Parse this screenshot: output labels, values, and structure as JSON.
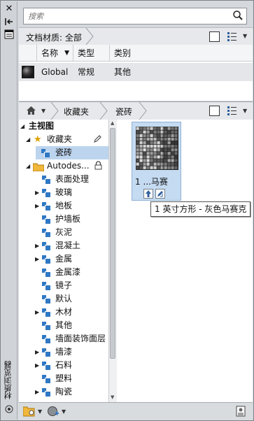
{
  "palette": {
    "accent": "#2f78c4",
    "selection": "#bcd4ee",
    "panel": "#d5d8dc"
  },
  "window": {
    "vertical_title": "材质浏览器"
  },
  "search": {
    "placeholder": "搜索",
    "icon": "search-icon"
  },
  "doc_materials": {
    "label": "文档材质: 全部"
  },
  "table": {
    "columns": [
      "名称",
      "类型",
      "类别"
    ],
    "rows": [
      {
        "name": "Global",
        "type": "常规",
        "category": "其他"
      }
    ]
  },
  "library_nav": {
    "breadcrumb": [
      "收藏夹",
      "瓷砖"
    ]
  },
  "tree": {
    "root": "主视图",
    "favorites": "收藏夹",
    "favorites_child": "瓷砖",
    "autodesk": "Autodes...",
    "items": [
      {
        "label": "表面处理",
        "expandable": false
      },
      {
        "label": "玻璃",
        "expandable": true
      },
      {
        "label": "地板",
        "expandable": true
      },
      {
        "label": "护墙板",
        "expandable": false
      },
      {
        "label": "灰泥",
        "expandable": false
      },
      {
        "label": "混凝土",
        "expandable": true
      },
      {
        "label": "金属",
        "expandable": true
      },
      {
        "label": "金属漆",
        "expandable": false
      },
      {
        "label": "镜子",
        "expandable": false
      },
      {
        "label": "默认",
        "expandable": false
      },
      {
        "label": "木材",
        "expandable": true
      },
      {
        "label": "其他",
        "expandable": false
      },
      {
        "label": "墙面装饰面层",
        "expandable": false
      },
      {
        "label": "墙漆",
        "expandable": true
      },
      {
        "label": "石料",
        "expandable": true
      },
      {
        "label": "塑料",
        "expandable": false
      },
      {
        "label": "陶瓷",
        "expandable": true
      }
    ]
  },
  "thumbnail": {
    "label": "1 ...马赛",
    "tooltip": "1 英寸方形 - 灰色马赛克"
  }
}
